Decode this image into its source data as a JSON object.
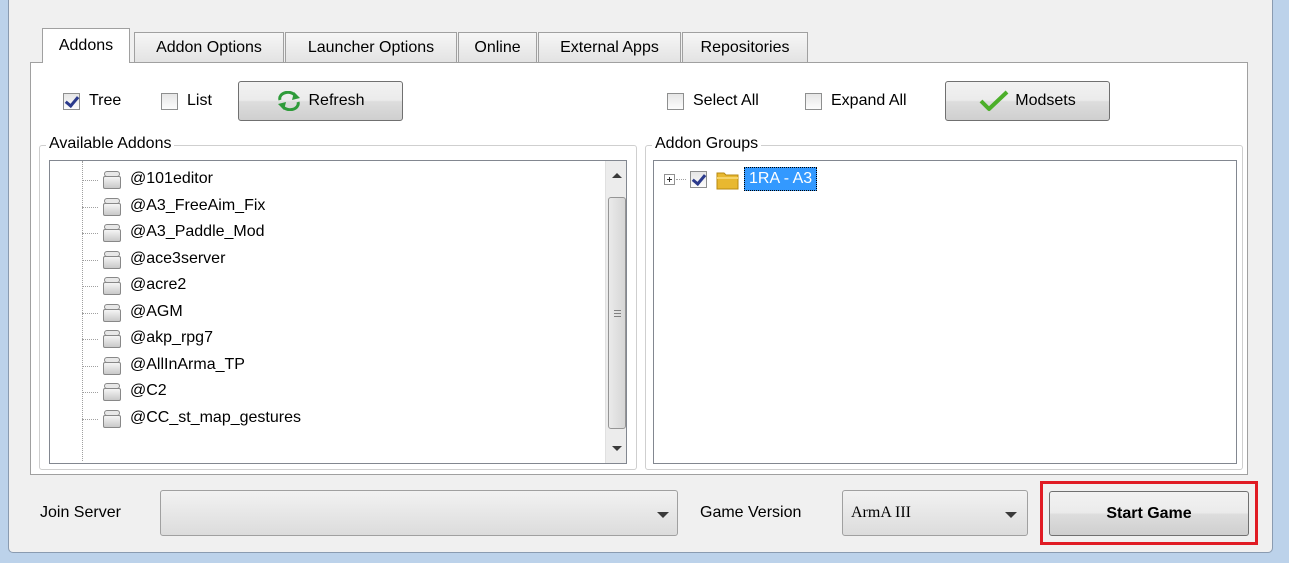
{
  "tabs": [
    {
      "label": "Addons",
      "active": true
    },
    {
      "label": "Addon Options",
      "active": false
    },
    {
      "label": "Launcher Options",
      "active": false
    },
    {
      "label": "Online",
      "active": false
    },
    {
      "label": "External Apps",
      "active": false
    },
    {
      "label": "Repositories",
      "active": false
    }
  ],
  "toolbar_left": {
    "tree_label": "Tree",
    "tree_checked": true,
    "list_label": "List",
    "list_checked": false,
    "refresh_label": "Refresh"
  },
  "toolbar_right": {
    "select_all_label": "Select All",
    "select_all_checked": false,
    "expand_all_label": "Expand All",
    "expand_all_checked": false,
    "modsets_label": "Modsets"
  },
  "available_addons": {
    "title": "Available Addons",
    "items": [
      "@101editor",
      "@A3_FreeAim_Fix",
      "@A3_Paddle_Mod",
      "@ace3server",
      "@acre2",
      "@AGM",
      "@akp_rpg7",
      "@AllInArma_TP",
      "@C2",
      "@CC_st_map_gestures"
    ]
  },
  "addon_groups": {
    "title": "Addon Groups",
    "items": [
      {
        "label": "1RA - A3",
        "checked": true,
        "selected": true
      }
    ]
  },
  "bottom": {
    "join_server_label": "Join Server",
    "join_server_value": "",
    "game_version_label": "Game Version",
    "game_version_value": "ArmA III",
    "start_game_label": "Start Game"
  },
  "colors": {
    "selection": "#3399ff",
    "highlight_border": "#e01b24",
    "modsets_check": "#4caf2a",
    "refresh_icon": "#2e9b3a",
    "folder": "#e8b830"
  }
}
